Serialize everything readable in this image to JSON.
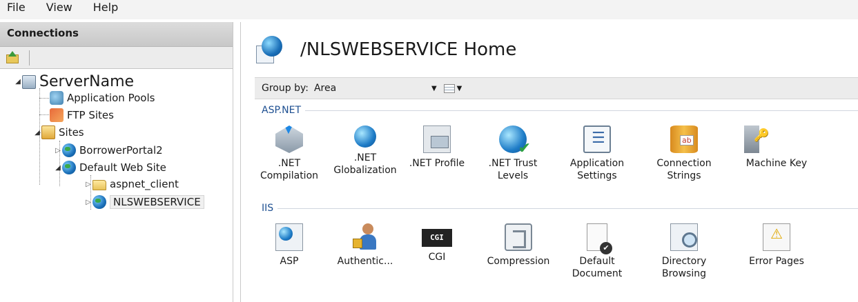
{
  "menu": {
    "items": [
      "File",
      "View",
      "Help"
    ]
  },
  "connections": {
    "header": "Connections",
    "tree": {
      "server": "ServerName",
      "app_pools": "Application Pools",
      "ftp_sites": "FTP Sites",
      "sites": "Sites",
      "borrower": "BorrowerPortal2",
      "default_site": "Default Web Site",
      "aspnet_client": "aspnet_client",
      "nlswebservice": "NLSWEBSERVICE"
    }
  },
  "main": {
    "title": "/NLSWEBSERVICE Home",
    "group_by_label": "Group by:",
    "group_by_value": "Area",
    "sections": {
      "aspnet": "ASP.NET",
      "iis": "IIS"
    },
    "aspnet_features": [
      ".NET\nCompilation",
      ".NET\nGlobalization",
      ".NET Profile",
      ".NET Trust\nLevels",
      "Application\nSettings",
      "Connection\nStrings",
      "Machine Key"
    ],
    "iis_features": [
      "ASP",
      "Authentic...",
      "CGI",
      "Compression",
      "Default\nDocument",
      "Directory\nBrowsing",
      "Error Pages"
    ],
    "cgi_badge": "CGI"
  }
}
